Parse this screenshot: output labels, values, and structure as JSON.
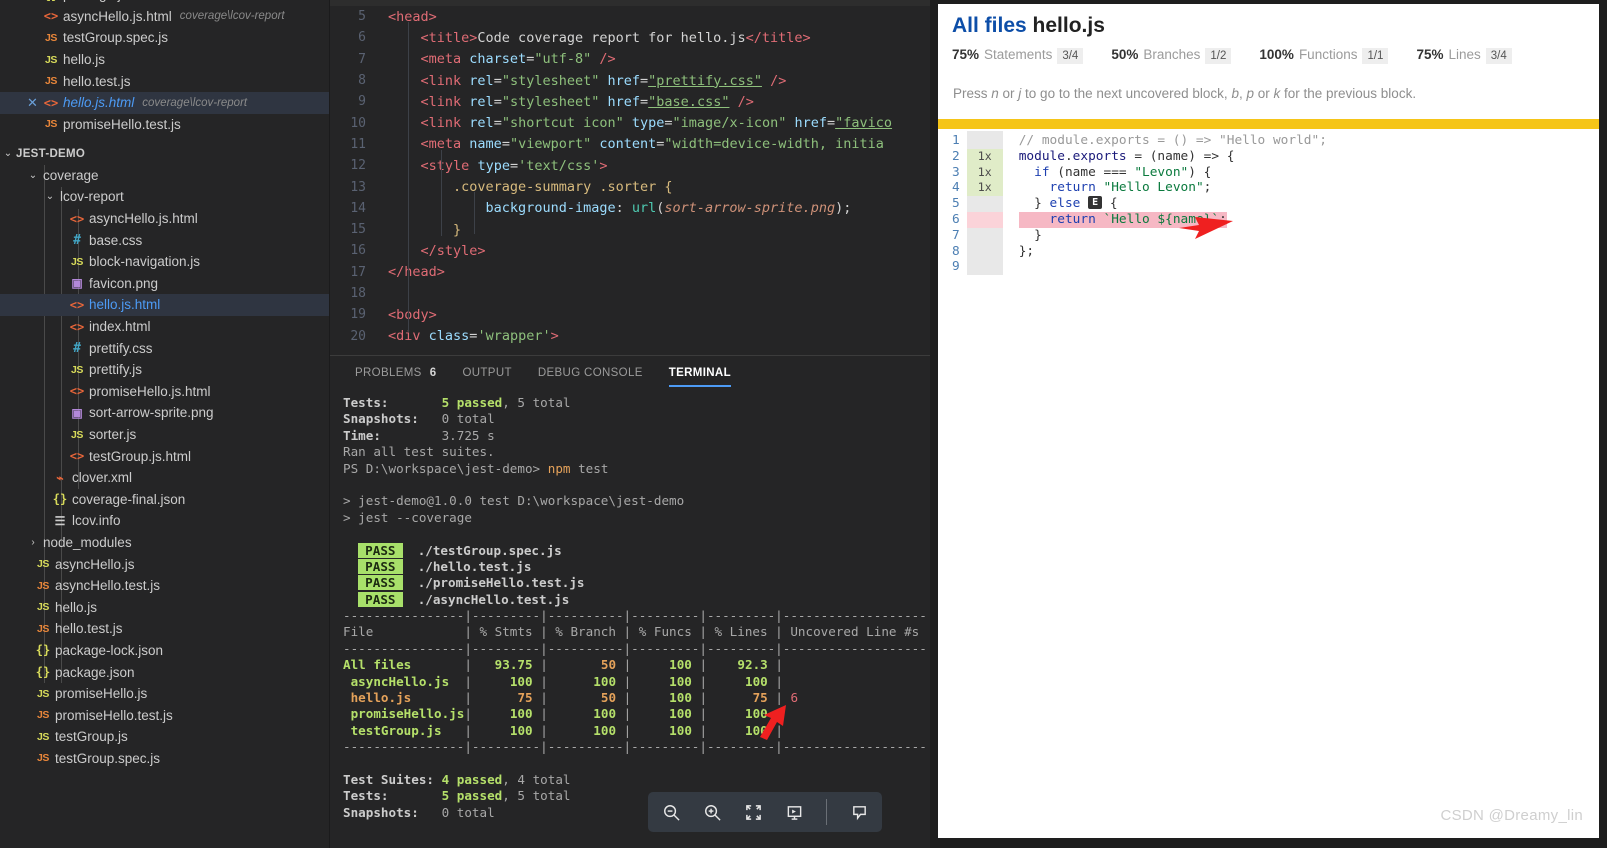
{
  "sidebar": {
    "open_editors": [
      {
        "icon": "json-icon",
        "name": "package.json",
        "desc": "",
        "state": "partial"
      },
      {
        "icon": "html-icon",
        "name": "asyncHello.js.html",
        "desc": "coverage\\lcov-report",
        "state": "normal"
      },
      {
        "icon": "js-test-icon",
        "name": "testGroup.spec.js",
        "desc": "",
        "state": "normal"
      },
      {
        "icon": "js-icon",
        "name": "hello.js",
        "desc": "",
        "state": "normal"
      },
      {
        "icon": "js-test-icon",
        "name": "hello.test.js",
        "desc": "",
        "state": "normal"
      },
      {
        "icon": "html-icon",
        "name": "hello.js.html",
        "desc": "coverage\\lcov-report",
        "state": "active"
      },
      {
        "icon": "js-test-icon",
        "name": "promiseHello.test.js",
        "desc": "",
        "state": "normal"
      }
    ],
    "workspace_root": "JEST-DEMO",
    "tree": [
      {
        "depth": 1,
        "type": "folder",
        "name": "coverage",
        "expanded": true
      },
      {
        "depth": 2,
        "type": "folder",
        "name": "lcov-report",
        "expanded": true
      },
      {
        "depth": 3,
        "type": "file",
        "icon": "html-icon",
        "name": "asyncHello.js.html"
      },
      {
        "depth": 3,
        "type": "file",
        "icon": "css-icon",
        "name": "base.css"
      },
      {
        "depth": 3,
        "type": "file",
        "icon": "js-icon",
        "name": "block-navigation.js"
      },
      {
        "depth": 3,
        "type": "file",
        "icon": "png-icon",
        "name": "favicon.png"
      },
      {
        "depth": 3,
        "type": "file",
        "icon": "html-icon",
        "name": "hello.js.html",
        "selected": true
      },
      {
        "depth": 3,
        "type": "file",
        "icon": "html-icon",
        "name": "index.html"
      },
      {
        "depth": 3,
        "type": "file",
        "icon": "css-icon",
        "name": "prettify.css"
      },
      {
        "depth": 3,
        "type": "file",
        "icon": "js-icon",
        "name": "prettify.js"
      },
      {
        "depth": 3,
        "type": "file",
        "icon": "html-icon",
        "name": "promiseHello.js.html"
      },
      {
        "depth": 3,
        "type": "file",
        "icon": "png-icon",
        "name": "sort-arrow-sprite.png"
      },
      {
        "depth": 3,
        "type": "file",
        "icon": "js-icon",
        "name": "sorter.js"
      },
      {
        "depth": 3,
        "type": "file",
        "icon": "html-icon",
        "name": "testGroup.js.html"
      },
      {
        "depth": 2,
        "type": "file",
        "icon": "xml-icon",
        "name": "clover.xml"
      },
      {
        "depth": 2,
        "type": "file",
        "icon": "json-icon",
        "name": "coverage-final.json"
      },
      {
        "depth": 2,
        "type": "file",
        "icon": "info-icon",
        "name": "lcov.info"
      },
      {
        "depth": 1,
        "type": "folder",
        "name": "node_modules",
        "expanded": false
      },
      {
        "depth": 1,
        "type": "file",
        "icon": "js-icon",
        "name": "asyncHello.js"
      },
      {
        "depth": 1,
        "type": "file",
        "icon": "js-test-icon",
        "name": "asyncHello.test.js"
      },
      {
        "depth": 1,
        "type": "file",
        "icon": "js-icon",
        "name": "hello.js"
      },
      {
        "depth": 1,
        "type": "file",
        "icon": "js-test-icon",
        "name": "hello.test.js"
      },
      {
        "depth": 1,
        "type": "file",
        "icon": "json-icon",
        "name": "package-lock.json"
      },
      {
        "depth": 1,
        "type": "file",
        "icon": "json-icon",
        "name": "package.json"
      },
      {
        "depth": 1,
        "type": "file",
        "icon": "js-icon",
        "name": "promiseHello.js"
      },
      {
        "depth": 1,
        "type": "file",
        "icon": "js-test-icon",
        "name": "promiseHello.test.js"
      },
      {
        "depth": 1,
        "type": "file",
        "icon": "js-icon",
        "name": "testGroup.js"
      },
      {
        "depth": 1,
        "type": "file",
        "icon": "js-test-icon",
        "name": "testGroup.spec.js"
      }
    ]
  },
  "editor": {
    "lines": [
      {
        "n": "5",
        "html": "<span class='t-tag'>&lt;head&gt;</span>"
      },
      {
        "n": "6",
        "html": "    <span class='t-tag'>&lt;title&gt;</span><span class='t-plain'>Code coverage report for hello.js</span><span class='t-tag'>&lt;/title&gt;</span>"
      },
      {
        "n": "7",
        "html": "    <span class='t-tag'>&lt;meta</span> <span class='t-attr'>charset</span><span class='t-plain'>=</span><span class='t-str'>\"utf-8\"</span> <span class='t-tag'>/&gt;</span>"
      },
      {
        "n": "8",
        "html": "    <span class='t-tag'>&lt;link</span> <span class='t-attr'>rel</span><span class='t-plain'>=</span><span class='t-str'>\"stylesheet\"</span> <span class='t-attr'>href</span><span class='t-plain'>=</span><span class='t-link'>\"prettify.css\"</span> <span class='t-tag'>/&gt;</span>"
      },
      {
        "n": "9",
        "html": "    <span class='t-tag'>&lt;link</span> <span class='t-attr'>rel</span><span class='t-plain'>=</span><span class='t-str'>\"stylesheet\"</span> <span class='t-attr'>href</span><span class='t-plain'>=</span><span class='t-link'>\"base.css\"</span> <span class='t-tag'>/&gt;</span>"
      },
      {
        "n": "10",
        "html": "    <span class='t-tag'>&lt;link</span> <span class='t-attr'>rel</span><span class='t-plain'>=</span><span class='t-str'>\"shortcut icon\"</span> <span class='t-attr'>type</span><span class='t-plain'>=</span><span class='t-str'>\"image/x-icon\"</span> <span class='t-attr'>href</span><span class='t-plain'>=</span><span class='t-link'>\"favico</span>"
      },
      {
        "n": "11",
        "html": "    <span class='t-tag'>&lt;meta</span> <span class='t-attr'>name</span><span class='t-plain'>=</span><span class='t-str'>\"viewport\"</span> <span class='t-attr'>content</span><span class='t-plain'>=</span><span class='t-str'>\"width=device-width, initia</span>"
      },
      {
        "n": "12",
        "html": "    <span class='t-tag'>&lt;style</span> <span class='t-attr'>type</span><span class='t-plain'>=</span><span class='t-str'>'text/css'</span><span class='t-tag'>&gt;</span>"
      },
      {
        "n": "13",
        "html": "        <span class='t-sel'>.coverage-summary .sorter</span> <span class='t-brace'>{</span>"
      },
      {
        "n": "14",
        "html": "            <span class='t-prop'>background-image</span><span class='t-plain'>: </span><span class='t-fn'>url</span><span class='t-plain'>(</span><span class='t-ital'>sort-arrow-sprite.png</span><span class='t-plain'>);</span>"
      },
      {
        "n": "15",
        "html": "        <span class='t-brace'>}</span>"
      },
      {
        "n": "16",
        "html": "    <span class='t-tag'>&lt;/style&gt;</span>"
      },
      {
        "n": "17",
        "html": "<span class='t-tag'>&lt;/head&gt;</span>"
      },
      {
        "n": "18",
        "html": ""
      },
      {
        "n": "19",
        "html": "<span class='t-tag'>&lt;body&gt;</span>"
      },
      {
        "n": "20",
        "html": "<span class='t-tag'>&lt;div</span> <span class='t-attr'>class</span><span class='t-plain'>=</span><span class='t-str'>'wrapper'</span><span class='t-tag'>&gt;</span>"
      }
    ]
  },
  "panel": {
    "tabs": [
      {
        "label": "PROBLEMS",
        "count": "6",
        "active": false
      },
      {
        "label": "OUTPUT",
        "count": "",
        "active": false
      },
      {
        "label": "DEBUG CONSOLE",
        "count": "",
        "active": false
      },
      {
        "label": "TERMINAL",
        "count": "",
        "active": true
      }
    ],
    "terminal_lines": [
      "<span class='b'>Tests:</span>       <span class='gb'>5 passed</span><span class='dim'>, 5 total</span>",
      "<span class='b'>Snapshots:</span>   <span class='dim'>0 total</span>",
      "<span class='b'>Time:</span>        <span class='dim'>3.725 s</span>",
      "<span class='dim'>Ran all test suites.</span>",
      "<span class='dim'>PS D:\\workspace\\jest-demo&gt;</span> <span class='orange'>npm</span><span class='dim'> test</span>",
      "",
      "<span class='dim'>&gt; jest-demo@1.0.0 test D:\\workspace\\jest-demo</span>",
      "<span class='dim'>&gt; jest --coverage</span>",
      "",
      "  <span class='passtag'>PASS</span>  <span class='b'>./testGroup.spec.js</span>",
      "  <span class='passtag'>PASS</span>  <span class='b'>./hello.test.js</span>",
      "  <span class='passtag'>PASS</span>  <span class='b'>./promiseHello.test.js</span>",
      "  <span class='passtag'>PASS</span>  <span class='b'>./asyncHello.test.js</span>",
      "<span class='dim'>----------------|---------|----------|---------|---------|-------------------</span>",
      "<span class='dim'>File            | % Stmts | % Branch | % Funcs | % Lines | Uncovered Line #s</span>",
      "<span class='dim'>----------------|---------|----------|---------|---------|-------------------</span>",
      "<span class='gb'>All files</span><span class='dim'>       |</span>   <span class='gb'>93.75</span> <span class='dim'>|</span>       <span class='orangeb'>50</span> <span class='dim'>|</span>     <span class='gb'>100</span> <span class='dim'>|</span>    <span class='gb'>92.3</span> <span class='dim'>|</span>",
      " <span class='gb'>asyncHello.js</span><span class='dim'>  |</span>     <span class='gb'>100</span> <span class='dim'>|</span>      <span class='gb'>100</span> <span class='dim'>|</span>     <span class='gb'>100</span> <span class='dim'>|</span>     <span class='gb'>100</span> <span class='dim'>|</span>",
      " <span class='orangeb'>hello.js</span><span class='dim'>       |</span>      <span class='orangeb'>75</span> <span class='dim'>|</span>       <span class='orangeb'>50</span> <span class='dim'>|</span>     <span class='gb'>100</span> <span class='dim'>|</span>      <span class='orangeb'>75</span> <span class='dim'>|</span> <span class='red'>6</span>",
      " <span class='gb'>promiseHello.js</span><span class='dim'>|</span>     <span class='gb'>100</span> <span class='dim'>|</span>      <span class='gb'>100</span> <span class='dim'>|</span>     <span class='gb'>100</span> <span class='dim'>|</span>     <span class='gb'>100</span> <span class='dim'>|</span>",
      " <span class='gb'>testGroup.js</span><span class='dim'>   |</span>     <span class='gb'>100</span> <span class='dim'>|</span>      <span class='gb'>100</span> <span class='dim'>|</span>     <span class='gb'>100</span> <span class='dim'>|</span>     <span class='gb'>100</span> <span class='dim'>|</span>",
      "<span class='dim'>----------------|---------|----------|---------|---------|-------------------</span>",
      "",
      "<span class='b'>Test Suites:</span> <span class='gb'>4 passed</span><span class='dim'>, 4 total</span>",
      "<span class='b'>Tests:</span>       <span class='gb'>5 passed</span><span class='dim'>, 5 total</span>",
      "<span class='b'>Snapshots:</span>   <span class='dim'>0 total</span>"
    ],
    "buttons": [
      {
        "name": "zoom-out-icon",
        "glyph": "zoom-out"
      },
      {
        "name": "zoom-in-icon",
        "glyph": "zoom-in"
      },
      {
        "name": "maximize-panel-icon",
        "glyph": "maximize"
      },
      {
        "name": "split-terminal-icon",
        "glyph": "split"
      },
      {
        "name": "feedback-icon",
        "glyph": "feedback"
      }
    ]
  },
  "report": {
    "breadcrumb_root": "All files",
    "breadcrumb_current": "hello.js",
    "stats": [
      {
        "pct": "75%",
        "label": "Statements",
        "frac": "3/4"
      },
      {
        "pct": "50%",
        "label": "Branches",
        "frac": "1/2"
      },
      {
        "pct": "100%",
        "label": "Functions",
        "frac": "1/1"
      },
      {
        "pct": "75%",
        "label": "Lines",
        "frac": "3/4"
      }
    ],
    "hint_parts": [
      "Press ",
      "n",
      " or ",
      "j",
      " to go to the next uncovered block, ",
      "b",
      ", ",
      "p",
      " or ",
      "k",
      " for the previous block."
    ],
    "accent_color": "#f5c518",
    "line_numbers": [
      "1",
      "2",
      "3",
      "4",
      "5",
      "6",
      "7",
      "8",
      "9"
    ],
    "hit_counts": [
      {
        "text": "",
        "state": "none"
      },
      {
        "text": "1x",
        "state": "hit"
      },
      {
        "text": "1x",
        "state": "hit"
      },
      {
        "text": "1x",
        "state": "hit"
      },
      {
        "text": "",
        "state": "none"
      },
      {
        "text": "",
        "state": "miss"
      },
      {
        "text": "",
        "state": "none"
      },
      {
        "text": "",
        "state": "none"
      },
      {
        "text": "",
        "state": "none"
      }
    ],
    "source_lines": [
      "<span class='cmt'>// module.exports = () =&gt; \"Hello world\";</span>",
      "<span class='obj'>module</span>.<span class='obj'>exports</span> = (name) =&gt; {",
      "  <span class='kw'>if</span> (name === <span class='str'>\"Levon\"</span>) {",
      "    <span class='kw'>return</span> <span class='str'>\"Hello Levon\"</span>;",
      "  } <span class='kw'>else</span> <span class='elsebadge'>E</span> {",
      "<span class='uncov'>    <span class='kw'>return</span> <span class='str'>`Hello ${name}`</span>;</span>",
      "  }",
      "};",
      ""
    ],
    "watermark": "CSDN @Dreamy_lin"
  }
}
